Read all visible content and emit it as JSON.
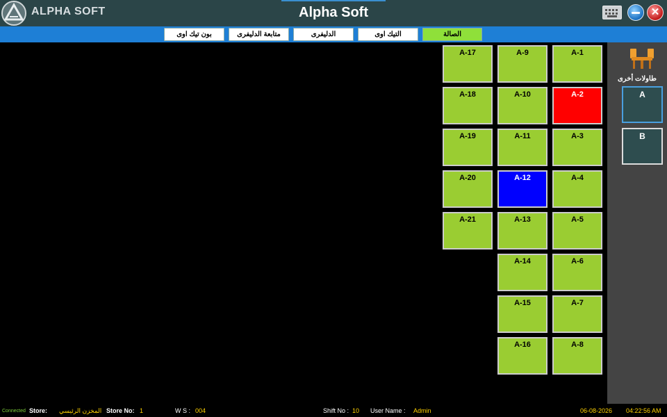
{
  "window": {
    "brand": "ALPHA SOFT",
    "title": "Alpha Soft"
  },
  "tabs": [
    {
      "label": "الصالة",
      "active": true
    },
    {
      "label": "التيك اوى",
      "active": false
    },
    {
      "label": "الدليفرى",
      "active": false
    },
    {
      "label": "متابعة الدليفرى",
      "active": false
    },
    {
      "label": "بون تيك اوى",
      "active": false
    }
  ],
  "tables": [
    {
      "label": "A-1",
      "status": "free"
    },
    {
      "label": "A-2",
      "status": "occupied"
    },
    {
      "label": "A-3",
      "status": "free"
    },
    {
      "label": "A-4",
      "status": "free"
    },
    {
      "label": "A-5",
      "status": "free"
    },
    {
      "label": "A-6",
      "status": "free"
    },
    {
      "label": "A-7",
      "status": "free"
    },
    {
      "label": "A-8",
      "status": "free"
    },
    {
      "label": "A-9",
      "status": "free"
    },
    {
      "label": "A-10",
      "status": "free"
    },
    {
      "label": "A-11",
      "status": "free"
    },
    {
      "label": "A-12",
      "status": "selected"
    },
    {
      "label": "A-13",
      "status": "free"
    },
    {
      "label": "A-14",
      "status": "free"
    },
    {
      "label": "A-15",
      "status": "free"
    },
    {
      "label": "A-16",
      "status": "free"
    },
    {
      "label": "A-17",
      "status": "free"
    },
    {
      "label": "A-18",
      "status": "free"
    },
    {
      "label": "A-19",
      "status": "free"
    },
    {
      "label": "A-20",
      "status": "free"
    },
    {
      "label": "A-21",
      "status": "free"
    }
  ],
  "sidebar": {
    "icon": "chairs-table-icon",
    "label": "طاولات أخرى",
    "sections": [
      {
        "label": "A",
        "selected": true
      },
      {
        "label": "B",
        "selected": false
      }
    ]
  },
  "status": {
    "connection": "Connected",
    "store_label": "Store:",
    "store_value": "المخزن الرئيسي",
    "store_no_label": "Store No:",
    "store_no_value": "1",
    "ws_label": "W S :",
    "ws_value": "004",
    "shift_label": "Shift No :",
    "shift_value": "10",
    "user_label": "User Name :",
    "user_value": "Admin",
    "date": "06-08-2026",
    "time": "04:22:56 AM"
  },
  "colors": {
    "free": "#9acd32",
    "occupied": "#ff0000",
    "selected": "#0000ff",
    "accent": "#1e7fd6"
  }
}
